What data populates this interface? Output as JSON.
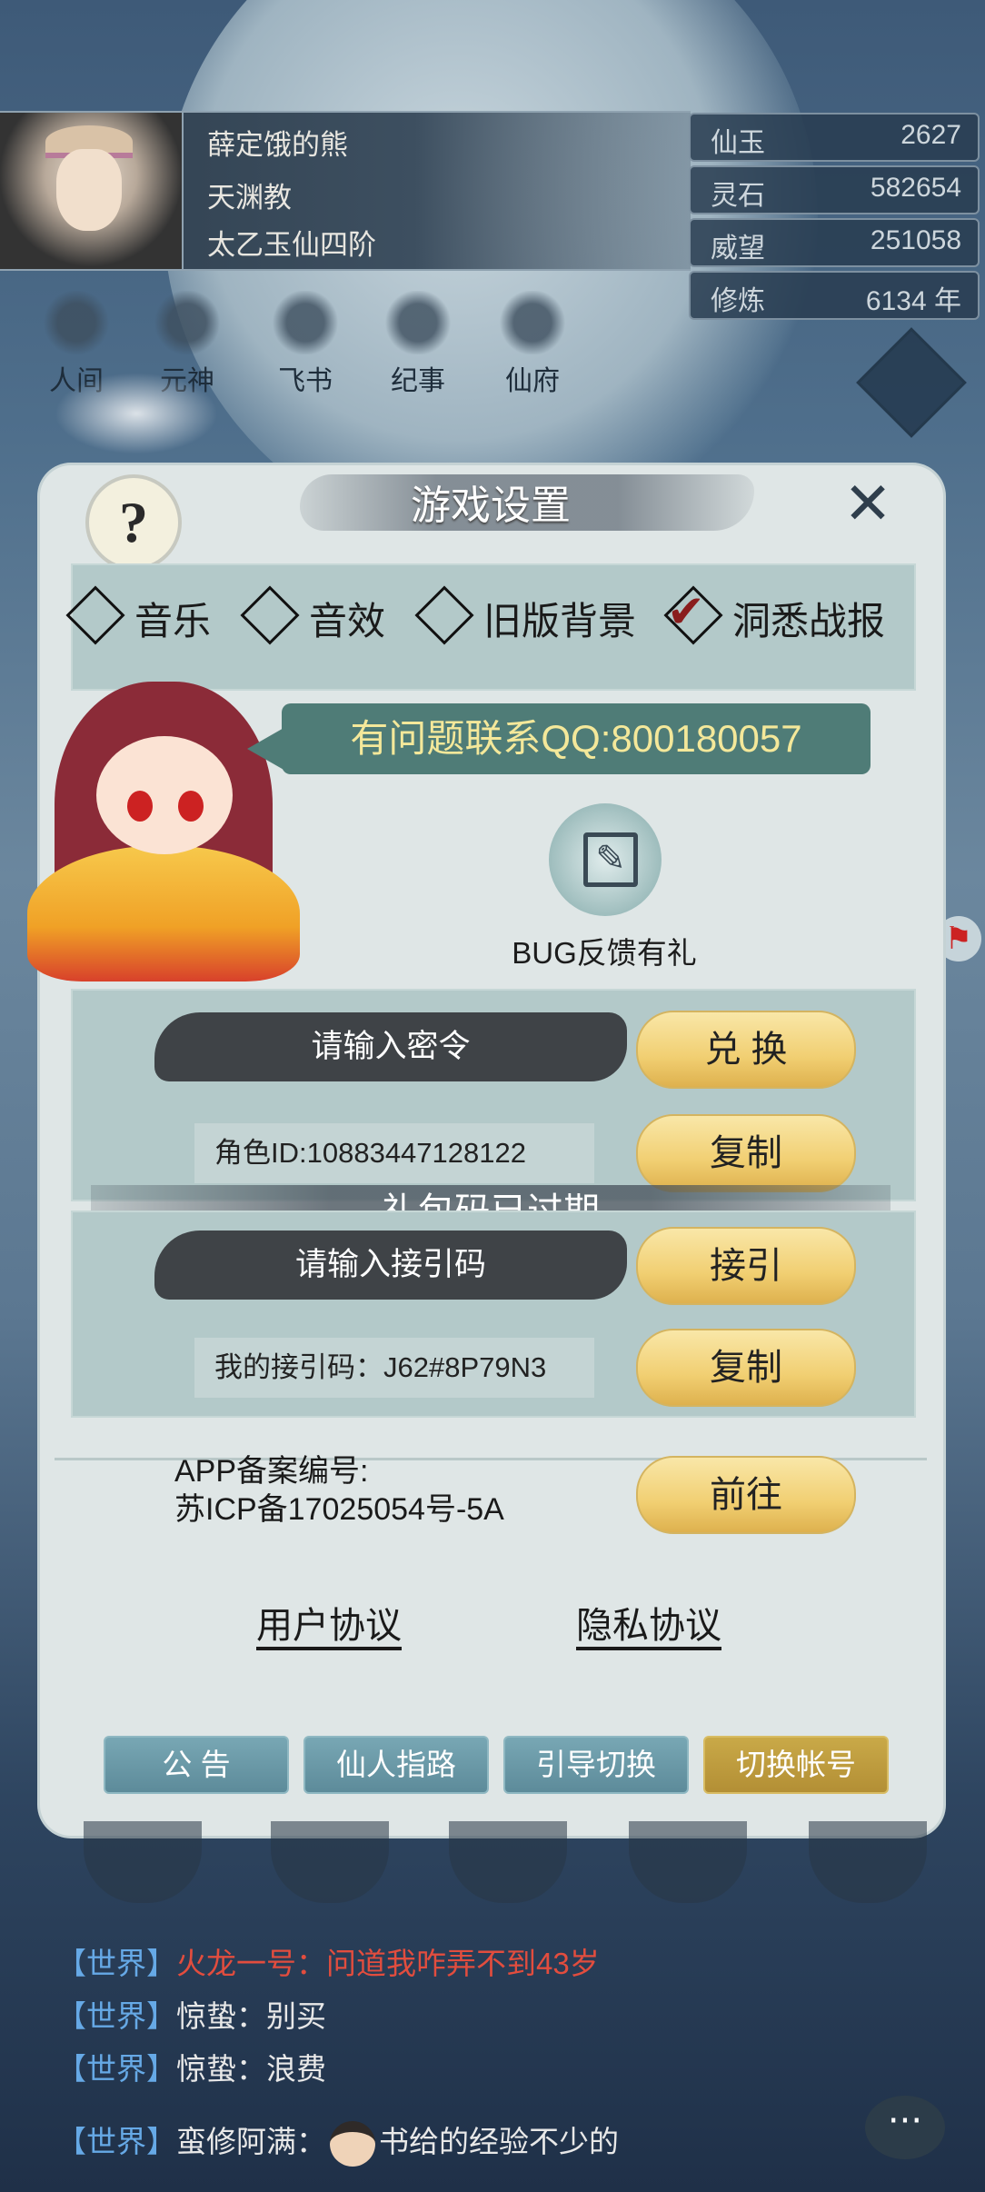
{
  "profile": {
    "name": "薛定饿的熊",
    "sect": "天渊教",
    "realm": "太乙玉仙四阶"
  },
  "stats": [
    {
      "label": "仙玉",
      "value": "2627"
    },
    {
      "label": "灵石",
      "value": "582654"
    },
    {
      "label": "威望",
      "value": "251058"
    },
    {
      "label": "修炼",
      "value": "6134 年"
    }
  ],
  "topnav": [
    "人间",
    "元神",
    "飞书",
    "纪事",
    "仙府"
  ],
  "settings": {
    "title": "游戏设置",
    "help": "?",
    "close": "✕",
    "options": [
      {
        "label": "音乐",
        "checked": false
      },
      {
        "label": "音效",
        "checked": false
      },
      {
        "label": "旧版背景",
        "checked": false
      },
      {
        "label": "洞悉战报",
        "checked": true
      }
    ],
    "qq_contact": "有问题联系QQ:800180057",
    "bug_label": "BUG反馈有礼",
    "password_placeholder": "请输入密令",
    "redeem_button": "兑 换",
    "role_id": "角色ID:10883447128122",
    "copy_button": "复制",
    "expired_notice": "礼包码已过期",
    "referral_placeholder": "请输入接引码",
    "referral_button": "接引",
    "my_referral_code": "我的接引码：J62#8P79N3",
    "copy_button_2": "复制",
    "icp_line1": "APP备案编号:",
    "icp_line2": "苏ICP备17025054号-5A",
    "goto_button": "前往",
    "user_agreement": "用户协议",
    "privacy_agreement": "隐私协议",
    "bottom_buttons": [
      "公 告",
      "仙人指路",
      "引导切换",
      "切换帐号"
    ]
  },
  "chat": [
    {
      "tag": "【世界】",
      "text": "火龙一号：问道我咋弄不到43岁",
      "red": true
    },
    {
      "tag": "【世界】",
      "text": "惊蛰：别买",
      "red": false
    },
    {
      "tag": "【世界】",
      "text": "惊蛰：浪费",
      "red": false
    },
    {
      "tag": "【世界】",
      "text": "蛮修阿满：",
      "text2": "书给的经验不少的",
      "red": false
    }
  ],
  "colors": {
    "accent_gold": "#f1cf72",
    "panel_teal": "#b3c9c9",
    "qq_bubble": "#4f7c77",
    "qq_text": "#f4e89a",
    "chat_tag": "#66a9e6",
    "chat_red": "#e24d3e"
  }
}
